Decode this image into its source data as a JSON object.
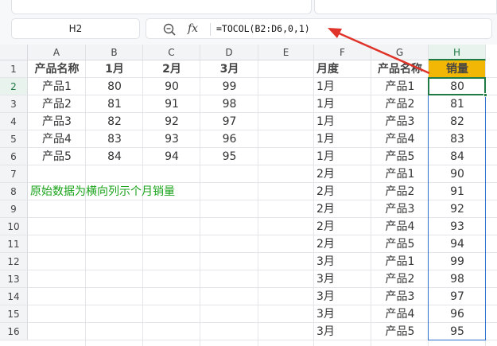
{
  "name_box": "H2",
  "formula_bar": {
    "fx_label": "fx",
    "formula": "=TOCOL(B2:D6,0,1)"
  },
  "columns": [
    "A",
    "B",
    "C",
    "D",
    "E",
    "F",
    "G",
    "H"
  ],
  "rows": [
    "1",
    "2",
    "3",
    "4",
    "5",
    "6",
    "7",
    "8",
    "9",
    "10",
    "11",
    "12",
    "13",
    "14",
    "15",
    "16"
  ],
  "source_table": {
    "headers": [
      "产品名称",
      "1月",
      "2月",
      "3月"
    ],
    "rows": [
      [
        "产品1",
        "80",
        "90",
        "99"
      ],
      [
        "产品2",
        "81",
        "91",
        "98"
      ],
      [
        "产品3",
        "82",
        "92",
        "97"
      ],
      [
        "产品4",
        "83",
        "93",
        "96"
      ],
      [
        "产品5",
        "84",
        "94",
        "95"
      ]
    ]
  },
  "note": "原始数据为横向列示个月销量",
  "result_table": {
    "headers": [
      "月度",
      "产品名称",
      "销量"
    ],
    "rows": [
      [
        "1月",
        "产品1",
        "80"
      ],
      [
        "1月",
        "产品2",
        "81"
      ],
      [
        "1月",
        "产品3",
        "82"
      ],
      [
        "1月",
        "产品4",
        "83"
      ],
      [
        "1月",
        "产品5",
        "84"
      ],
      [
        "2月",
        "产品1",
        "90"
      ],
      [
        "2月",
        "产品2",
        "91"
      ],
      [
        "2月",
        "产品3",
        "92"
      ],
      [
        "2月",
        "产品4",
        "93"
      ],
      [
        "2月",
        "产品5",
        "94"
      ],
      [
        "3月",
        "产品1",
        "99"
      ],
      [
        "3月",
        "产品2",
        "98"
      ],
      [
        "3月",
        "产品3",
        "97"
      ],
      [
        "3月",
        "产品4",
        "96"
      ],
      [
        "3月",
        "产品5",
        "95"
      ]
    ]
  },
  "icons": {
    "zoom": "zoom-out-icon",
    "function": "fx-icon"
  },
  "colors": {
    "highlight": "#f2b705",
    "note": "#1aa31a",
    "selection": "#1f7a45",
    "range": "#2f6ccf",
    "arrow": "#e0342b"
  }
}
